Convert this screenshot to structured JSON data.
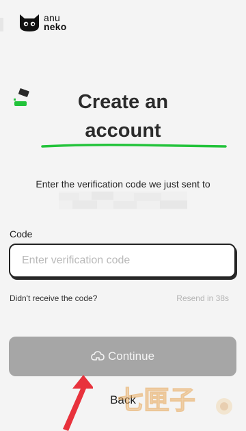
{
  "logo": {
    "line1": "anu",
    "line2": "neko"
  },
  "title": {
    "line1": "Create an",
    "line2": "account"
  },
  "subtitle": "Enter the verification code we just sent to",
  "code": {
    "label": "Code",
    "placeholder": "Enter verification code",
    "value": ""
  },
  "resend": {
    "question": "Didn't receive the code?",
    "timer": "Resend in 38s"
  },
  "buttons": {
    "continue": "Continue",
    "back": "Back"
  },
  "watermark": {
    "text": "七匣子"
  },
  "colors": {
    "accent_green": "#22c33a",
    "button_disabled": "#a6a6a6",
    "annotation_arrow": "#e8323c",
    "background": "#f4f4f4"
  },
  "icons": {
    "continue": "cloud-icon",
    "logo": "cat-icon",
    "decor": "sparkle-icon"
  }
}
